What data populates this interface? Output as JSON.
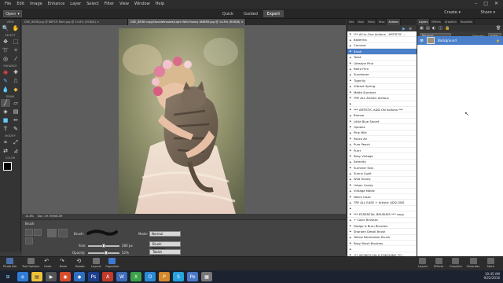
{
  "menubar": {
    "items": [
      "File",
      "Edit",
      "Image",
      "Enhance",
      "Layer",
      "Select",
      "Filter",
      "View",
      "Window",
      "Help"
    ],
    "window_controls": [
      "–",
      "□",
      "✕"
    ]
  },
  "modebar": {
    "open_label": "Open",
    "tabs": [
      "Quick",
      "Guided",
      "Expert"
    ],
    "active_tab": "Expert",
    "create_label": "Create",
    "share_label": "Share"
  },
  "toolbox": {
    "sections": [
      "VIEW",
      "SELECT",
      "ENHANCE",
      "DRAW",
      "MODIFY",
      "COLOR"
    ]
  },
  "document_tabs": [
    "DSE_8838.jpg @ 88PCR Rem.jpg @ 14.8% (RGB/8) ×",
    "DSE_8838 copy/Doubletrouble/Light Wild Honey AMBER.jpg @ 14.8% (RGB/8) ×"
  ],
  "status": {
    "zoom": "14.8%",
    "doc_size": "Doc: 29.7M/66.2M"
  },
  "tool_options": {
    "tool_name": "Brush",
    "brush_label": "Brush:",
    "size_label": "Size:",
    "size_value": "280 px",
    "opacity_label": "Opacity:",
    "opacity_value": "52%",
    "mode_label": "Mode:",
    "mode_value": "Normal",
    "brush_settings_label": "Brush Settings...",
    "tablet_settings_label": "Tablet Settings..."
  },
  "actions_panel": {
    "tabs": [
      "Info",
      "Navi",
      "Histo",
      "Favo",
      "Actions"
    ],
    "active_tab": "Actions",
    "items": [
      {
        "label": "*** All-in-One Actions - ARTISTIC ...",
        "selected": false
      },
      {
        "label": "Ballerina",
        "selected": false
      },
      {
        "label": "Carnival",
        "selected": false
      },
      {
        "label": "Blush",
        "selected": true
      },
      {
        "label": "Twist",
        "selected": false
      },
      {
        "label": "Lifestyle Pink",
        "selected": false
      },
      {
        "label": "Retro Film",
        "selected": false
      },
      {
        "label": "Sundrover",
        "selected": false
      },
      {
        "label": "Tigerlily",
        "selected": false
      },
      {
        "label": "Vibrant Spring",
        "selected": false
      },
      {
        "label": "Matte Summer",
        "selected": false
      },
      {
        "label": "TRY ALL Artistic Actions",
        "selected": false
      },
      {
        "label": "",
        "selected": false
      },
      {
        "label": "*** ARTISTIC ADD-ON Actions ***",
        "selected": false
      },
      {
        "label": "Bronze",
        "selected": false
      },
      {
        "label": "Little Blue Secret",
        "selected": false
      },
      {
        "label": "Ophelia",
        "selected": false
      },
      {
        "label": "Pink Milk",
        "selected": false
      },
      {
        "label": "Police All",
        "selected": false
      },
      {
        "label": "Pure Peach",
        "selected": false
      },
      {
        "label": "Purrr",
        "selected": false
      },
      {
        "label": "Rosy Vintage",
        "selected": false
      },
      {
        "label": "Serenity",
        "selected": false
      },
      {
        "label": "Summer Skin",
        "selected": false
      },
      {
        "label": "Sunny Light",
        "selected": false
      },
      {
        "label": "Wild Honey",
        "selected": false
      },
      {
        "label": "Urban Candy",
        "selected": false
      },
      {
        "label": "Vintage Matte",
        "selected": false
      },
      {
        "label": "Warm Haze",
        "selected": false
      },
      {
        "label": "TRY ALL EASE + Artistic ADD-ONS",
        "selected": false
      },
      {
        "label": "",
        "selected": false
      },
      {
        "label": "*** ESSENTIAL BRUSHES *** copy",
        "selected": false
      },
      {
        "label": "+ Color Brushes",
        "selected": false
      },
      {
        "label": "Dodge & Burn Brushes",
        "selected": false
      },
      {
        "label": "Sharpen Detail Brush",
        "selected": false
      },
      {
        "label": "Yellow Neutralizer Brush",
        "selected": false
      },
      {
        "label": "Rosy Blush Brushes",
        "selected": false
      },
      {
        "label": "",
        "selected": false
      },
      {
        "label": "*** WORKFLOW & FINISHING TO...",
        "selected": false
      }
    ]
  },
  "layers_panel": {
    "tabs": [
      "Layers",
      "Effects",
      "Graphics",
      "Favorites"
    ],
    "active_tab": "Layers",
    "blend_mode": "Normal",
    "opacity_label": "Opacity:",
    "opacity_value": "100%",
    "layer_name": "Background"
  },
  "bottombar": {
    "items": [
      "Photo Bin",
      "Tool Options",
      "Undo",
      "Redo",
      "Rotate",
      "Layout",
      "Organizer"
    ],
    "right_items": [
      "Layers",
      "Effects",
      "Graphics",
      "Favorites",
      "More"
    ]
  },
  "taskbar": {
    "time": "10:45 AM",
    "date": "9/22/2016"
  },
  "colors": {
    "accent": "#4a7fc9",
    "foreground": "#000000",
    "background": "#ffffff"
  }
}
